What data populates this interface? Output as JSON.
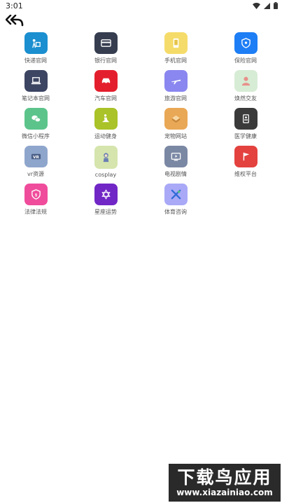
{
  "status_bar": {
    "time": "3:01"
  },
  "colors": {
    "kuaidi": "#1b8fd0",
    "yinhang": "#353d4f",
    "shouji": "#f5dc6a",
    "baoxian": "#1e7ef5",
    "bijiben": "#3c4562",
    "qiche": "#e41f2d",
    "lvyou": "#8a87f0",
    "huanxin": "#d7ecd5",
    "weixin": "#5cc48b",
    "yundong": "#a9c328",
    "chongwu": "#e9a855",
    "yixue": "#3a3a3a",
    "vr": "#8fa6cc",
    "cosplay": "#d5e5ad",
    "dianshi": "#7b88a4",
    "weiquan": "#e3423f",
    "falv": "#f04c9c",
    "xingzuo": "#7127c6",
    "tiyu": "#a9a9f7"
  },
  "apps": [
    {
      "label": "快递官网",
      "icon": "delivery-icon"
    },
    {
      "label": "银行官网",
      "icon": "bank-card-icon"
    },
    {
      "label": "手机官网",
      "icon": "phone-icon"
    },
    {
      "label": "保险官网",
      "icon": "shield-icon"
    },
    {
      "label": "笔记本官网",
      "icon": "laptop-icon"
    },
    {
      "label": "汽车官网",
      "icon": "car-icon"
    },
    {
      "label": "旅游官网",
      "icon": "airplane-icon"
    },
    {
      "label": "焕然交友",
      "icon": "friends-icon"
    },
    {
      "label": "微信小程序",
      "icon": "wechat-icon"
    },
    {
      "label": "运动健身",
      "icon": "fitness-icon"
    },
    {
      "label": "宠物网站",
      "icon": "pet-icon"
    },
    {
      "label": "医学健康",
      "icon": "medical-icon"
    },
    {
      "label": "vr资源",
      "icon": "vr-icon"
    },
    {
      "label": "cosplay",
      "icon": "cosplay-icon"
    },
    {
      "label": "电视剧情",
      "icon": "tv-icon"
    },
    {
      "label": "维权平台",
      "icon": "flag-icon"
    },
    {
      "label": "法律法规",
      "icon": "law-icon"
    },
    {
      "label": "星座运势",
      "icon": "star-icon"
    },
    {
      "label": "体育咨询",
      "icon": "sports-icon"
    }
  ],
  "watermark": {
    "title": "下载鸟应用",
    "url": "www.xiazainiao.com"
  }
}
